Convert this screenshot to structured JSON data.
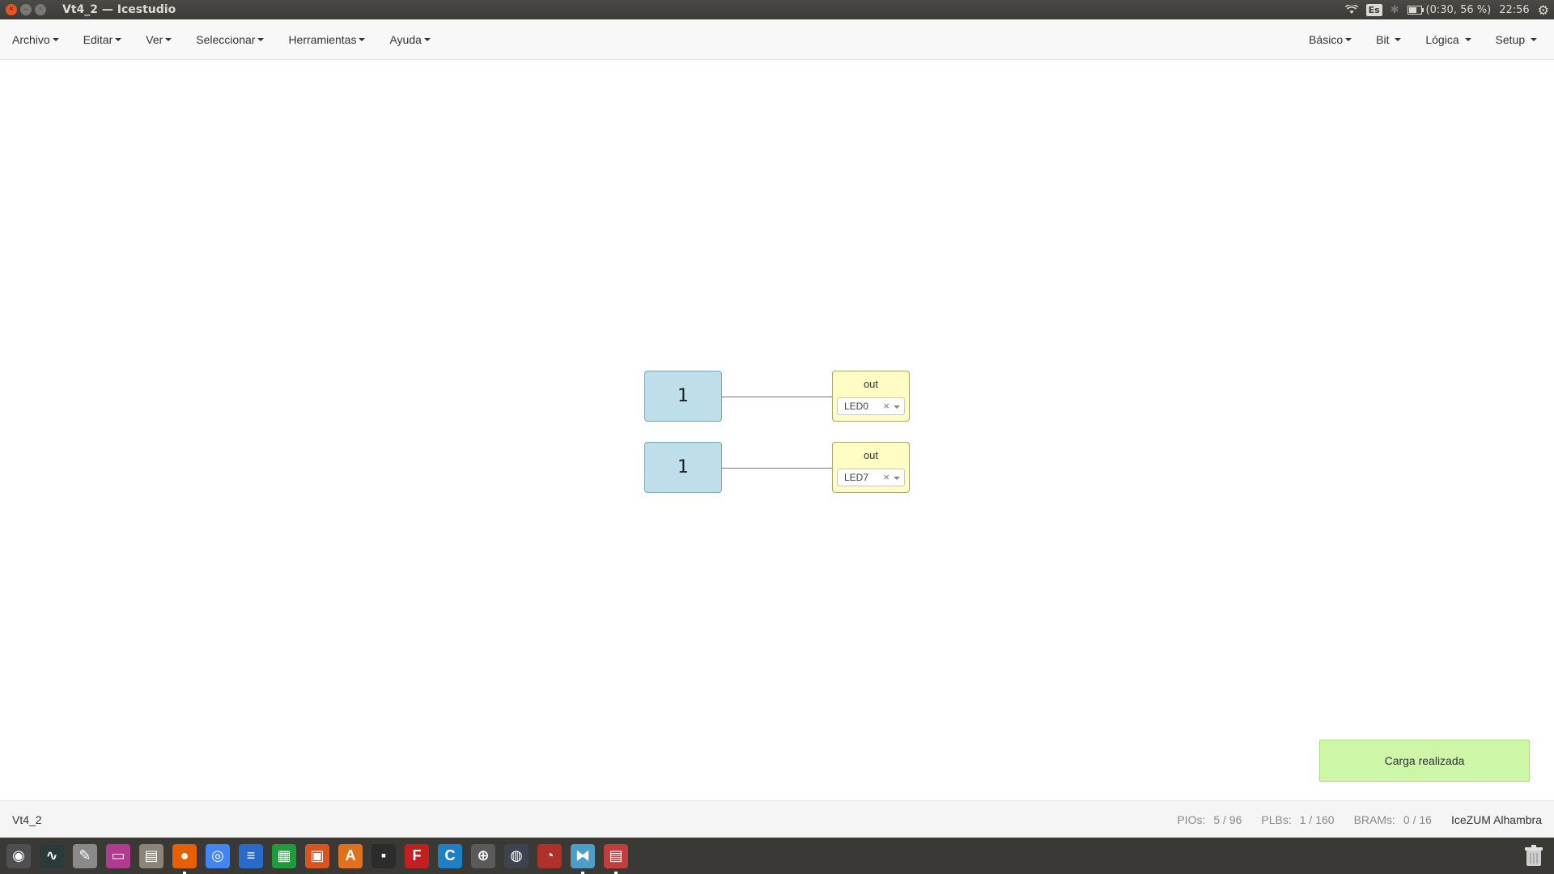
{
  "window": {
    "title": "Vt4_2 — Icestudio"
  },
  "tray": {
    "keyboard_layout": "Es",
    "battery_text": "(0:30, 56 %)",
    "clock": "22:56"
  },
  "menubar": {
    "left": [
      {
        "label": "Archivo"
      },
      {
        "label": "Editar"
      },
      {
        "label": "Ver"
      },
      {
        "label": "Seleccionar"
      },
      {
        "label": "Herramientas"
      },
      {
        "label": "Ayuda"
      }
    ],
    "right": [
      {
        "label": "Básico"
      },
      {
        "label": "Bit"
      },
      {
        "label": "Lógica"
      },
      {
        "label": "Setup"
      }
    ]
  },
  "canvas": {
    "constants": [
      {
        "value": "1"
      },
      {
        "value": "1"
      }
    ],
    "outputs": [
      {
        "label": "out",
        "pin": "LED0"
      },
      {
        "label": "out",
        "pin": "LED7"
      }
    ]
  },
  "toast": {
    "message": "Carga realizada"
  },
  "footer": {
    "project_name": "Vt4_2",
    "pios_label": "PIOs:",
    "pios_value": "5 / 96",
    "plbs_label": "PLBs:",
    "plbs_value": "1 / 160",
    "brams_label": "BRAMs:",
    "brams_value": "0 / 16",
    "board": "IceZUM Alhambra"
  },
  "dock": {
    "icons": [
      {
        "name": "ubuntu-search-icon",
        "color": "#4f4f52"
      },
      {
        "name": "system-monitor-icon",
        "color": "#2a3a3a"
      },
      {
        "name": "settings-tools-icon",
        "color": "#8a8a8a"
      },
      {
        "name": "terminal-icon",
        "color": "#b03c8f"
      },
      {
        "name": "file-manager-icon",
        "color": "#8a8479"
      },
      {
        "name": "firefox-icon",
        "color": "#e66000"
      },
      {
        "name": "chrome-icon",
        "color": "#4285f4"
      },
      {
        "name": "writer-icon",
        "color": "#2a6acb"
      },
      {
        "name": "calc-icon",
        "color": "#1e9c3a"
      },
      {
        "name": "impress-icon",
        "color": "#d9541e"
      },
      {
        "name": "software-center-icon",
        "color": "#e2711d"
      },
      {
        "name": "dark-terminal-icon",
        "color": "#2c2c2c"
      },
      {
        "name": "freecad-icon",
        "color": "#c22020"
      },
      {
        "name": "cura-icon",
        "color": "#1e7fc4"
      },
      {
        "name": "crosshair-app-icon",
        "color": "#5a5a5a"
      },
      {
        "name": "steam-icon",
        "color": "#3d4450"
      },
      {
        "name": "backup-icon",
        "color": "#b0302a"
      },
      {
        "name": "icestudio-icon",
        "color": "#4c9ec9"
      },
      {
        "name": "files-running-icon",
        "color": "#c43d3d"
      }
    ]
  }
}
